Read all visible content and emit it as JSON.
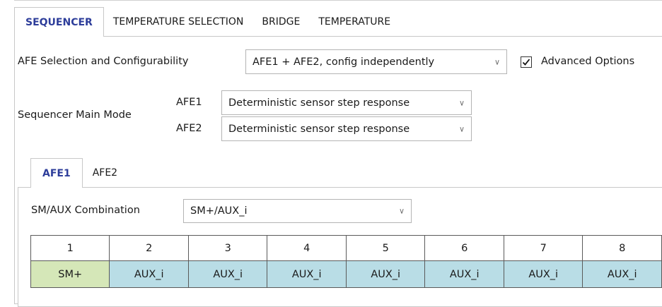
{
  "tabs": [
    {
      "label": "SEQUENCER",
      "active": true
    },
    {
      "label": "TEMPERATURE SELECTION",
      "active": false
    },
    {
      "label": "BRIDGE",
      "active": false
    },
    {
      "label": "TEMPERATURE",
      "active": false
    }
  ],
  "afe_selection": {
    "label": "AFE Selection and Configurability",
    "value": "AFE1 + AFE2, config independently"
  },
  "advanced_options": {
    "label": "Advanced Options",
    "checked": true
  },
  "sequencer_main_mode": {
    "label": "Sequencer Main Mode",
    "afe1": {
      "label": "AFE1",
      "value": "Deterministic sensor step response"
    },
    "afe2": {
      "label": "AFE2",
      "value": "Deterministic sensor step response"
    }
  },
  "afe_tabs": [
    {
      "label": "AFE1",
      "active": true
    },
    {
      "label": "AFE2",
      "active": false
    }
  ],
  "sm_aux_combination": {
    "label": "SM/AUX Combination",
    "value": "SM+/AUX_i"
  },
  "sequence_table": {
    "headers": [
      "1",
      "2",
      "3",
      "4",
      "5",
      "6",
      "7",
      "8"
    ],
    "values": [
      "SM+",
      "AUX_i",
      "AUX_i",
      "AUX_i",
      "AUX_i",
      "AUX_i",
      "AUX_i",
      "AUX_i"
    ]
  },
  "colors": {
    "active_tab_text": "#2d3d9a",
    "sm_cell": "#d5e7b8",
    "aux_cell": "#b9dde6"
  },
  "icons": {
    "dropdown": "chevron-down-icon",
    "check": "checkmark-icon"
  }
}
